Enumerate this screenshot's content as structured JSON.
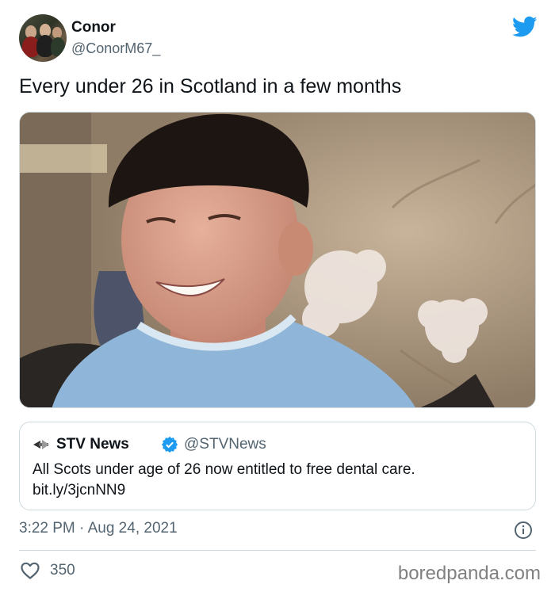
{
  "tweet": {
    "display_name": "Conor",
    "handle": "@ConorM67_",
    "text": "Every under 26 in Scotland in a few months",
    "timestamp": "3:22 PM · Aug 24, 2021",
    "like_count": "350"
  },
  "quoted_tweet": {
    "display_name": "STV News",
    "handle": "@STVNews",
    "text_line1": "All Scots under age of 26 now entitled to free dental care.",
    "text_line2": "bit.ly/3jcnNN9",
    "verified": true
  },
  "icons": {
    "brand": "twitter-bird-icon",
    "info": "info-icon",
    "like": "heart-icon",
    "verified": "verified-badge-icon"
  },
  "colors": {
    "twitter_blue": "#1d9bf0",
    "secondary_text": "#536471",
    "border": "#cfd9de"
  },
  "watermark": "boredpanda.com"
}
